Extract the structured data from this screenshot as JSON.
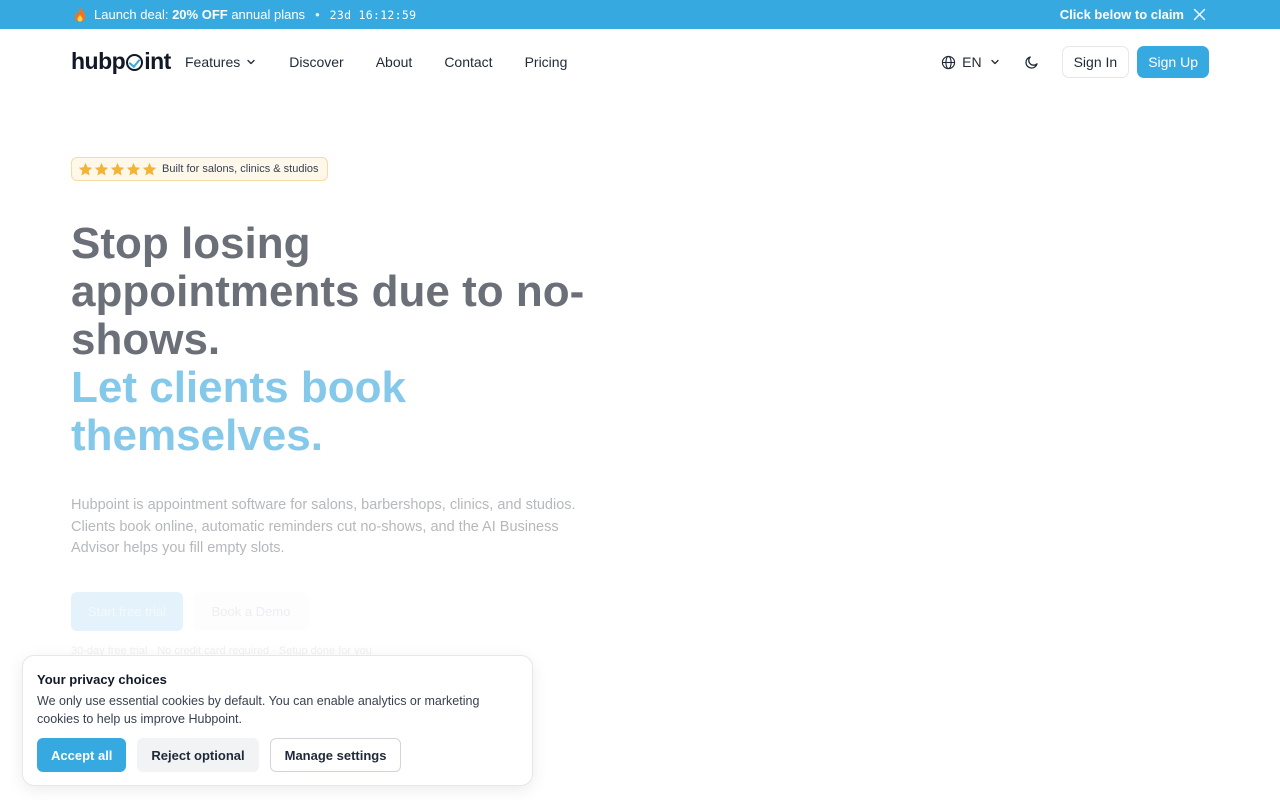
{
  "promo": {
    "prefix": "Launch deal:",
    "highlight": "20% OFF",
    "suffix": "annual plans",
    "separator": "•",
    "timer": "23d 16:12:59",
    "claim": "Click below to claim",
    "icon": "flame-icon"
  },
  "nav": {
    "logo_pre": "hubp",
    "logo_post": "int",
    "links": {
      "features": "Features",
      "discover": "Discover",
      "about": "About",
      "contact": "Contact",
      "pricing": "Pricing"
    },
    "language": "EN",
    "signin": "Sign In",
    "signup": "Sign Up"
  },
  "hero": {
    "badge": "Built for salons, clinics & studios",
    "rating_stars": 5,
    "headline_line1": "Stop losing",
    "headline_line2": "appointments due to no-",
    "headline_line3": "shows.",
    "accent_line1": "Let clients book",
    "accent_line2": "themselves.",
    "sub_line1": "Hubpoint is appointment software for salons, barbershops, clinics, and studios.",
    "sub_line2": "Clients book online, automatic reminders cut no-shows, and the AI Business",
    "sub_line3": "Advisor helps you fill empty slots.",
    "cta_primary": "Start free trial",
    "cta_secondary": "Book a Demo",
    "cta_note": "30-day free trial · No credit card required · Setup done for you"
  },
  "cookie": {
    "title": "Your privacy choices",
    "body": "We only use essential cookies by default. You can enable analytics or marketing cookies to help us improve Hubpoint.",
    "accept": "Accept all",
    "reject": "Reject optional",
    "manage": "Manage settings"
  },
  "colors": {
    "brand": "#36a9e1",
    "headline": "#6b7078",
    "accent_text": "#84c8ea",
    "star": "#f5b335"
  }
}
